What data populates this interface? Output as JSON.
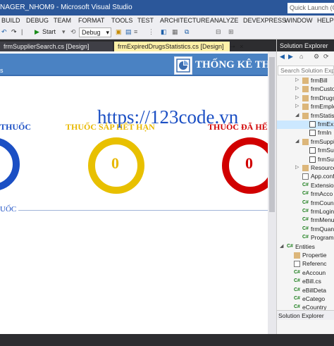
{
  "titlebar": {
    "title": "NAGER_NHOM9 - Microsoft Visual Studio",
    "quick_launch_placeholder": "Quick Launch (C"
  },
  "menu": [
    "BUILD",
    "DEBUG",
    "TEAM",
    "FORMAT",
    "TOOLS",
    "TEST",
    "ARCHITECTURE",
    "ANALYZE",
    "DEVEXPRESS",
    "WINDOW",
    "HELP"
  ],
  "toolbar": {
    "start_label": "Start",
    "config_value": "Debug"
  },
  "tabs": [
    {
      "label": "frmSupplierSearch.cs [Design]",
      "active": false
    },
    {
      "label": "frmExpiredDrugsStatistics.cs [Design]",
      "active": true
    }
  ],
  "designer": {
    "panel_header_fragment": "s",
    "panel_title": "THỐNG KÊ THU",
    "watermark": "https://123code.vn",
    "stats": [
      {
        "label": "THUỐC",
        "value": "",
        "color": "#1b4fc4"
      },
      {
        "label": "THUỐC SẮP HẾT HẠN",
        "value": "0",
        "color": "#e8b800"
      },
      {
        "label": "THUỐC ĐÃ HẾ",
        "value": "0",
        "color": "#d10000"
      }
    ],
    "group_label": "UỐC"
  },
  "solution_explorer": {
    "title": "Solution Explorer",
    "search_placeholder": "Search Solution Explor",
    "items": [
      {
        "label": "frmBill",
        "icon": "folder",
        "expanded": false
      },
      {
        "label": "frmCusto",
        "icon": "folder",
        "expanded": false
      },
      {
        "label": "frmDrugs",
        "icon": "folder",
        "expanded": false
      },
      {
        "label": "frmEmplo",
        "icon": "folder",
        "expanded": false
      },
      {
        "label": "frmStatis",
        "icon": "folder",
        "expanded": true
      },
      {
        "label": "frmEx",
        "icon": "form",
        "selected": true
      },
      {
        "label": "frmIn",
        "icon": "form"
      },
      {
        "label": "frmSuppl",
        "icon": "folder",
        "expanded": true
      },
      {
        "label": "frmSu",
        "icon": "form"
      },
      {
        "label": "frmSu",
        "icon": "form"
      },
      {
        "label": "Resource",
        "icon": "folder",
        "expanded": false
      },
      {
        "label": "App.confi",
        "icon": "cfg"
      },
      {
        "label": "Extension",
        "icon": "cs"
      },
      {
        "label": "frmAcco",
        "icon": "cs"
      },
      {
        "label": "frmCoun",
        "icon": "cs"
      },
      {
        "label": "frmLogin",
        "icon": "cs"
      },
      {
        "label": "frmMenu",
        "icon": "cs"
      },
      {
        "label": "frmQuan",
        "icon": "cs"
      },
      {
        "label": "Program",
        "icon": "cs"
      },
      {
        "label": "Entities",
        "icon": "cs",
        "expanded": true
      },
      {
        "label": "Propertie",
        "icon": "folder"
      },
      {
        "label": "Referenc",
        "icon": "cfg"
      },
      {
        "label": "eAccoun",
        "icon": "cs"
      },
      {
        "label": "eBill.cs",
        "icon": "cs"
      },
      {
        "label": "eBillDeta",
        "icon": "cs"
      },
      {
        "label": "eCatego",
        "icon": "cs"
      },
      {
        "label": "eCountry",
        "icon": "cs"
      }
    ],
    "bottom_tab": "Solution Explorer"
  },
  "colors": {
    "titlebar": "#2b579a",
    "accent_blue": "#1b4fc4",
    "accent_yellow": "#e8b800",
    "accent_red": "#d10000"
  }
}
